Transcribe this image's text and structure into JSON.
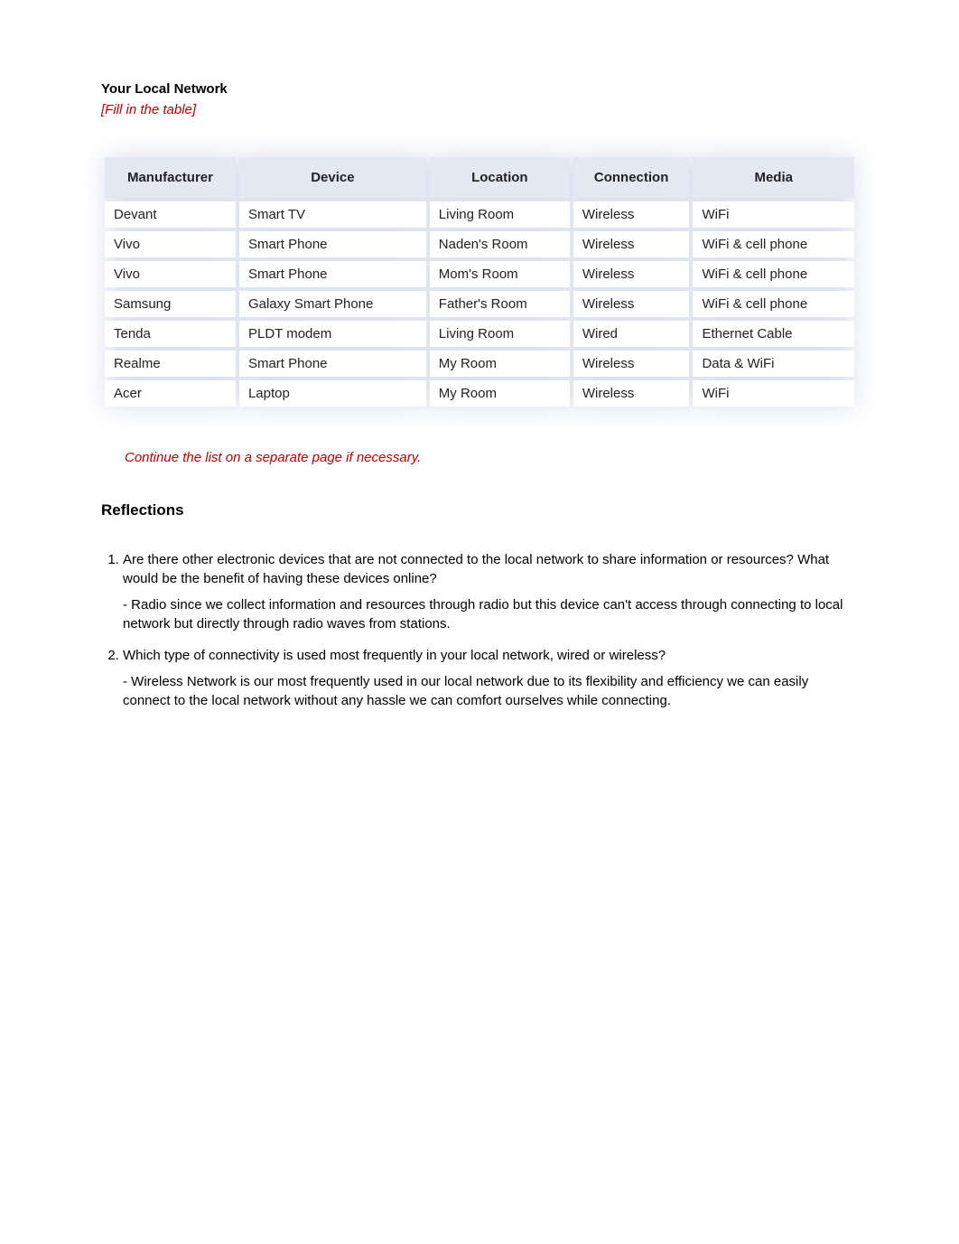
{
  "header": {
    "title": "Your Local Network",
    "instruction": "[Fill in the table]"
  },
  "table": {
    "columns": [
      "Manufacturer",
      "Device",
      "Location",
      "Connection",
      "Media"
    ],
    "rows": [
      {
        "manufacturer": "Devant",
        "device": "Smart TV",
        "location": "Living Room",
        "connection": "Wireless",
        "media": "WiFi"
      },
      {
        "manufacturer": "Vivo",
        "device": "Smart Phone",
        "location": "Naden's Room",
        "connection": "Wireless",
        "media": "WiFi & cell phone"
      },
      {
        "manufacturer": "Vivo",
        "device": "Smart Phone",
        "location": "Mom's Room",
        "connection": "Wireless",
        "media": "WiFi & cell phone"
      },
      {
        "manufacturer": "Samsung",
        "device": "Galaxy Smart Phone",
        "location": "Father's Room",
        "connection": "Wireless",
        "media": "WiFi & cell phone"
      },
      {
        "manufacturer": "Tenda",
        "device": "PLDT modem",
        "location": "Living Room",
        "connection": "Wired",
        "media": "Ethernet Cable"
      },
      {
        "manufacturer": "Realme",
        "device": "Smart Phone",
        "location": "My Room",
        "connection": "Wireless",
        "media": "Data & WiFi"
      },
      {
        "manufacturer": "Acer",
        "device": "Laptop",
        "location": "My Room",
        "connection": "Wireless",
        "media": "WiFi"
      }
    ]
  },
  "continue_note": "Continue the list on a separate page if necessary.",
  "reflections": {
    "heading": "Reflections",
    "items": [
      {
        "question": "Are there other electronic devices that are not connected to the local network to share information or resources? What would be the benefit of having these devices online?",
        "answer": "- Radio since we collect information and resources through radio but this device can't access through connecting to local network but directly through radio waves from stations."
      },
      {
        "question": "Which type of connectivity is used most frequently in your local network, wired or wireless?",
        "answer": "- Wireless Network is our most frequently used in our local network due to its flexibility and efficiency we can easily connect to the local network without any hassle we can comfort ourselves while connecting."
      }
    ]
  }
}
